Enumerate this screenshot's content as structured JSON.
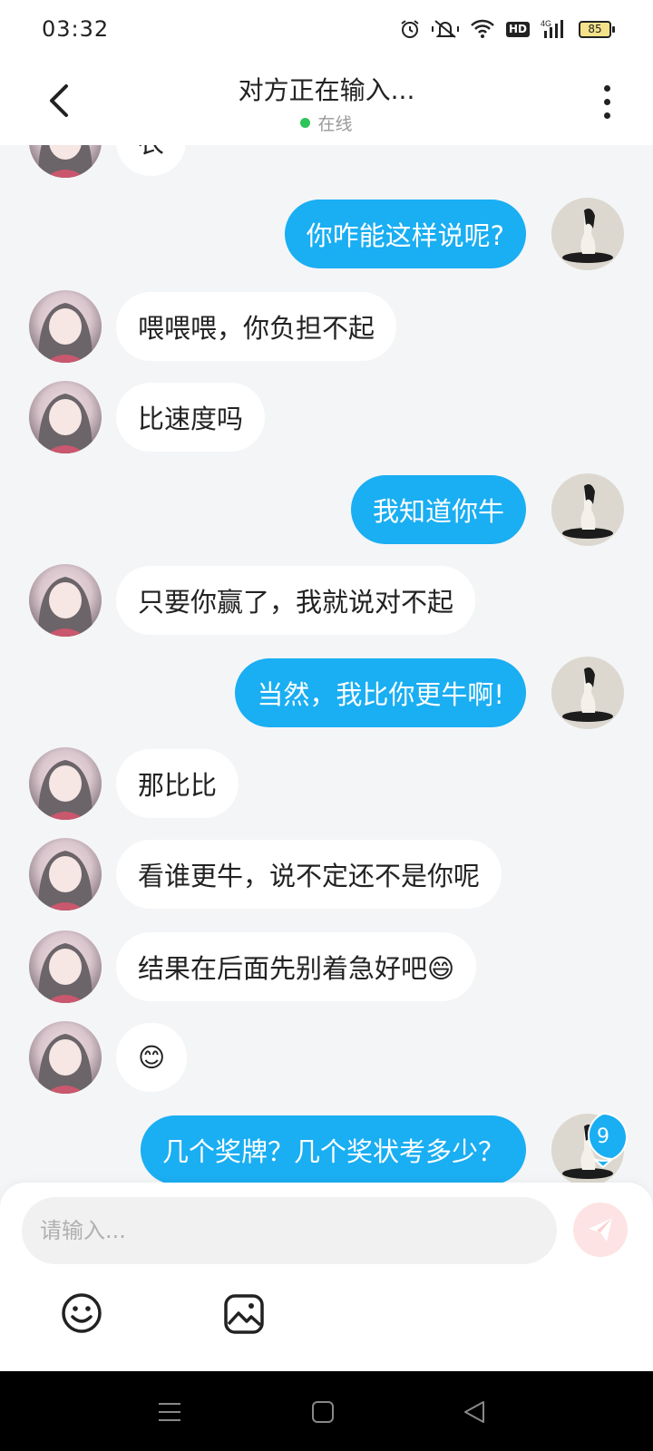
{
  "status_bar": {
    "time": "03:32",
    "network": "4G",
    "hd": "HD",
    "battery": "85"
  },
  "header": {
    "title": "对方正在输入...",
    "status": "在线",
    "online_color": "#2ec45a"
  },
  "messages": [
    {
      "side": "left",
      "text": "衣"
    },
    {
      "side": "right",
      "text": "你咋能这样说呢?"
    },
    {
      "side": "left",
      "text": "喂喂喂，你负担不起"
    },
    {
      "side": "left",
      "text": "比速度吗"
    },
    {
      "side": "right",
      "text": "我知道你牛"
    },
    {
      "side": "left",
      "text": "只要你赢了，我就说对不起"
    },
    {
      "side": "right",
      "text": "当然，我比你更牛啊!"
    },
    {
      "side": "left",
      "text": "那比比"
    },
    {
      "side": "left",
      "text": "看谁更牛，说不定还不是你呢"
    },
    {
      "side": "left",
      "text": "结果在后面先别着急好吧😄"
    },
    {
      "side": "left",
      "text": "😊"
    },
    {
      "side": "right",
      "text": "几个奖牌？几个奖状考多少？"
    }
  ],
  "unread_badge": "9",
  "input": {
    "placeholder": "请输入...",
    "value": ""
  },
  "icons": {
    "back": "chevron-left-icon",
    "more": "more-vertical-icon",
    "send": "paper-plane-icon",
    "emoji": "smiley-icon",
    "image": "image-icon"
  },
  "colors": {
    "bubble_right": "#1aaef2",
    "bubble_left": "#ffffff",
    "background": "#f4f5f7",
    "send_button_bg": "#fde3e3",
    "badge": "#1aaef2"
  }
}
